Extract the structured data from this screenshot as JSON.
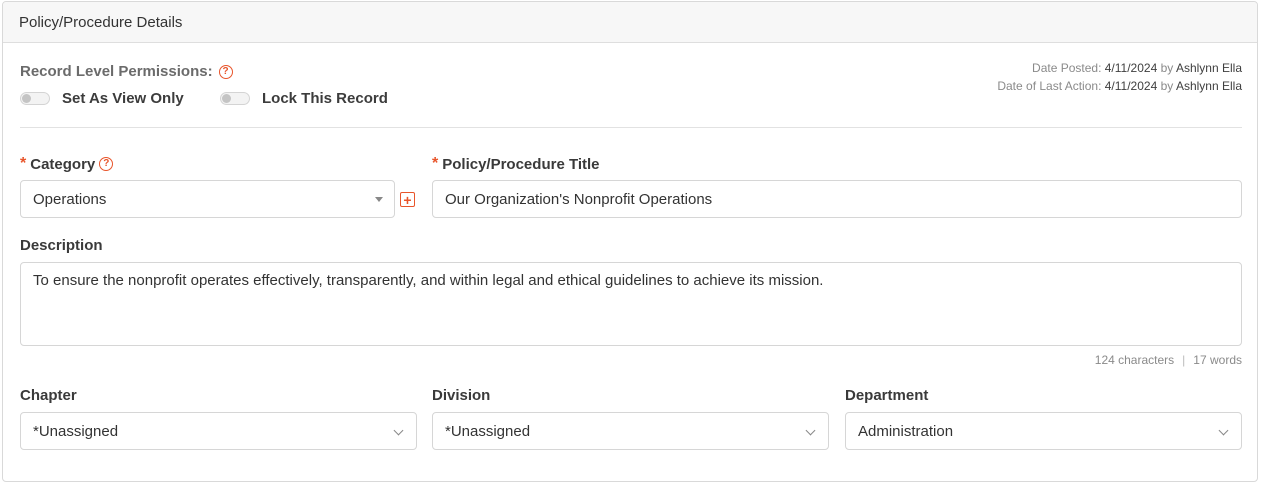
{
  "panel": {
    "title": "Policy/Procedure Details"
  },
  "permissions": {
    "label": "Record Level Permissions:",
    "view_only_label": "Set As View Only",
    "lock_label": "Lock This Record"
  },
  "meta": {
    "date_posted_label": "Date Posted:",
    "date_posted": "4/11/2024",
    "posted_by_word": "by",
    "posted_by": "Ashlynn Ella",
    "last_action_label": "Date of Last Action:",
    "last_action": "4/11/2024",
    "action_by_word": "by",
    "action_by": "Ashlynn Ella"
  },
  "form": {
    "required_mark": "*",
    "category_label": "Category",
    "category_value": "Operations",
    "title_label": "Policy/Procedure Title",
    "title_value": "Our Organization's Nonprofit Operations",
    "description_label": "Description",
    "description_value": "To ensure the nonprofit operates effectively, transparently, and within legal and ethical guidelines to achieve its mission.",
    "char_count": "124 characters",
    "count_separator": "|",
    "word_count": "17 words",
    "chapter_label": "Chapter",
    "chapter_value": "*Unassigned",
    "division_label": "Division",
    "division_value": "*Unassigned",
    "department_label": "Department",
    "department_value": "Administration"
  },
  "icons": {
    "help_glyph": "?",
    "plus_glyph": "+"
  },
  "colors": {
    "accent": "#e8552b",
    "header_bg": "#f7f7f7",
    "border": "#d6d6d6"
  }
}
